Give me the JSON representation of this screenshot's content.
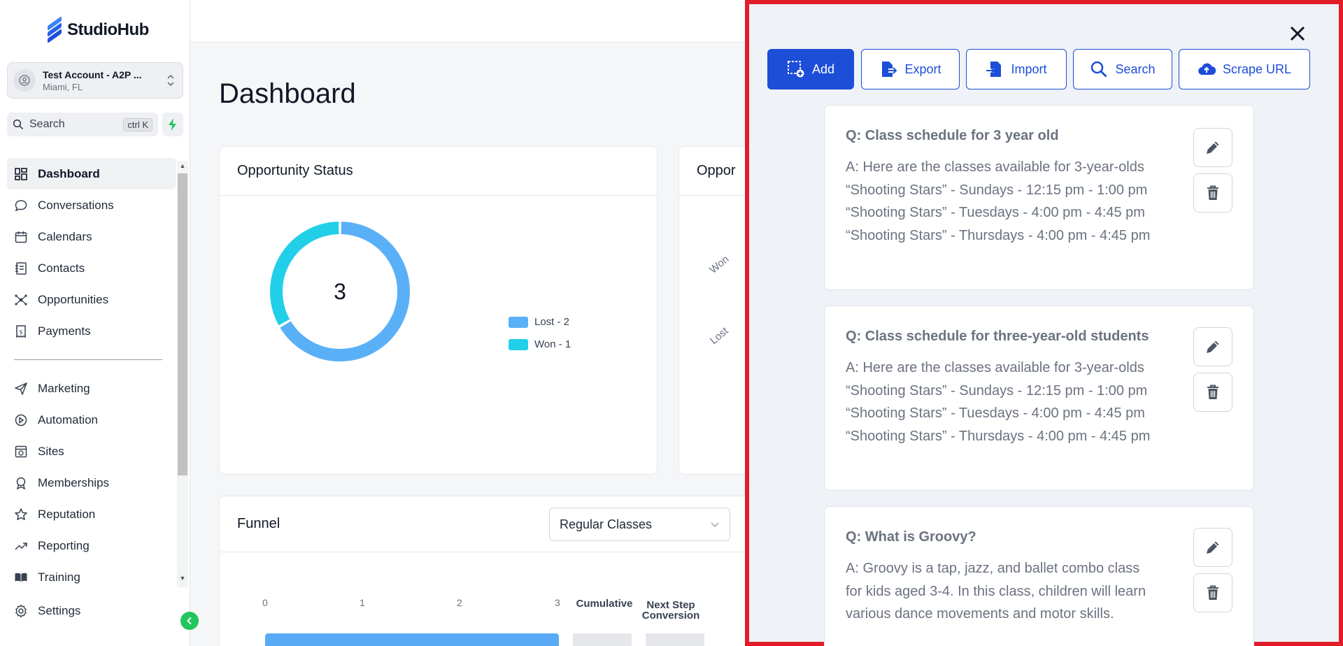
{
  "app": {
    "name": "StudioHub"
  },
  "account": {
    "name": "Test Account - A2P ...",
    "location": "Miami, FL"
  },
  "search": {
    "placeholder": "Search",
    "shortcut": "ctrl K"
  },
  "nav": {
    "primary": [
      {
        "label": "Dashboard",
        "icon": "dashboard-icon",
        "active": true
      },
      {
        "label": "Conversations",
        "icon": "chat-icon"
      },
      {
        "label": "Calendars",
        "icon": "calendar-icon"
      },
      {
        "label": "Contacts",
        "icon": "contacts-icon"
      },
      {
        "label": "Opportunities",
        "icon": "opportunities-icon"
      },
      {
        "label": "Payments",
        "icon": "payments-icon"
      }
    ],
    "secondary": [
      {
        "label": "Marketing",
        "icon": "send-icon"
      },
      {
        "label": "Automation",
        "icon": "automation-icon"
      },
      {
        "label": "Sites",
        "icon": "sites-icon"
      },
      {
        "label": "Memberships",
        "icon": "badge-icon"
      },
      {
        "label": "Reputation",
        "icon": "star-icon"
      },
      {
        "label": "Reporting",
        "icon": "trend-icon"
      },
      {
        "label": "Training",
        "icon": "book-icon"
      }
    ],
    "settings": "Settings"
  },
  "dashboard": {
    "title": "Dashboard",
    "opportunity_status": {
      "title": "Opportunity Status",
      "total": "3",
      "legend": [
        {
          "label": "Lost - 2",
          "color": "#5ab0f7"
        },
        {
          "label": "Won - 1",
          "color": "#22cfe8"
        }
      ]
    },
    "opportunity_value": {
      "title": "Oppor",
      "labels": [
        "Won",
        "Lost"
      ]
    },
    "funnel": {
      "title": "Funnel",
      "selected": "Regular Classes",
      "axis": [
        "0",
        "1",
        "2",
        "3"
      ],
      "col_cumulative": "Cumulative",
      "col_next_1": "Next Step",
      "col_next_2": "Conversion"
    }
  },
  "chart_data": {
    "type": "pie",
    "title": "Opportunity Status",
    "categories": [
      "Lost",
      "Won"
    ],
    "values": [
      2,
      1
    ],
    "colors": [
      "#5ab0f7",
      "#22cfe8"
    ],
    "donut": true,
    "center_label": "3"
  },
  "panel": {
    "toolbar": {
      "add": "Add",
      "export": "Export",
      "import": "Import",
      "search": "Search",
      "scrape": "Scrape URL"
    },
    "faqs": [
      {
        "q": "Q: Class schedule for 3 year old",
        "a": "A: Here are the classes available for 3-year-olds “Shooting Stars” - Sundays - 12:15 pm - 1:00 pm “Shooting Stars” - Tuesdays - 4:00 pm - 4:45 pm “Shooting Stars” - Thursdays - 4:00 pm - 4:45 pm"
      },
      {
        "q": "Q: Class schedule for three-year-old students",
        "a": "A: Here are the classes available for 3-year-olds “Shooting Stars” - Sundays - 12:15 pm - 1:00 pm “Shooting Stars” - Tuesdays - 4:00 pm - 4:45 pm “Shooting Stars” - Thursdays - 4:00 pm - 4:45 pm"
      },
      {
        "q": "Q: What is Groovy?",
        "a": "A: Groovy is a tap, jazz, and ballet combo class for kids aged 3-4. In this class, children will learn various dance movements and motor skills."
      }
    ]
  }
}
